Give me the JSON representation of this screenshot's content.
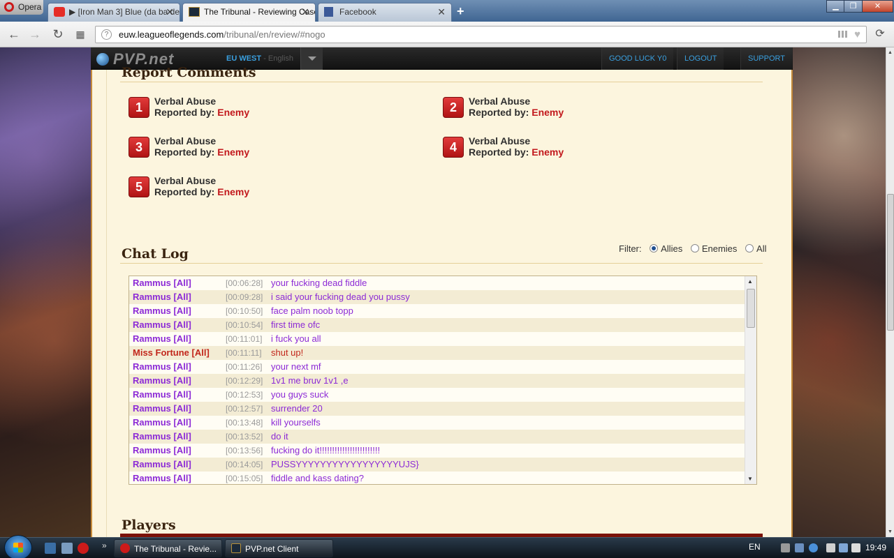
{
  "browser": {
    "menu_label": "Opera",
    "tabs": [
      {
        "label": "▶ [Iron Man 3] Blue (da ba dee)",
        "active": false,
        "icon": "youtube-icon"
      },
      {
        "label": "The Tribunal - Reviewing Case",
        "active": true,
        "icon": "lol-icon"
      },
      {
        "label": "Facebook",
        "active": false,
        "icon": "facebook-icon"
      }
    ],
    "url_host": "euw.leagueoflegends.com",
    "url_path": "/tribunal/en/review/#nogo"
  },
  "pvp_nav": {
    "logo": "PVP.net",
    "region": "EU WEST",
    "language": "English",
    "links": [
      "GOOD LUCK Y0",
      "LOGOUT",
      "SUPPORT"
    ]
  },
  "report_section": {
    "title": "Report Comments",
    "reported_by_label": "Reported by:",
    "reports": [
      {
        "num": "1",
        "type": "Verbal Abuse",
        "by": "Enemy"
      },
      {
        "num": "2",
        "type": "Verbal Abuse",
        "by": "Enemy"
      },
      {
        "num": "3",
        "type": "Verbal Abuse",
        "by": "Enemy"
      },
      {
        "num": "4",
        "type": "Verbal Abuse",
        "by": "Enemy"
      },
      {
        "num": "5",
        "type": "Verbal Abuse",
        "by": "Enemy"
      }
    ]
  },
  "chat_section": {
    "title": "Chat Log",
    "filter_label": "Filter:",
    "filter_options": [
      "Allies",
      "Enemies",
      "All"
    ],
    "filter_selected": "Allies",
    "rows": [
      {
        "name": "Rammus [All]",
        "time": "[00:06:28]",
        "msg": "your fucking dead fiddle",
        "side": "ally"
      },
      {
        "name": "Rammus [All]",
        "time": "[00:09:28]",
        "msg": "i said your fucking dead you pussy",
        "side": "ally"
      },
      {
        "name": "Rammus [All]",
        "time": "[00:10:50]",
        "msg": "face palm noob topp",
        "side": "ally"
      },
      {
        "name": "Rammus [All]",
        "time": "[00:10:54]",
        "msg": "first time ofc",
        "side": "ally"
      },
      {
        "name": "Rammus [All]",
        "time": "[00:11:01]",
        "msg": "i fuck you all",
        "side": "ally"
      },
      {
        "name": "Miss Fortune [All]",
        "time": "[00:11:11]",
        "msg": "shut up!",
        "side": "enemy"
      },
      {
        "name": "Rammus [All]",
        "time": "[00:11:26]",
        "msg": "your next mf",
        "side": "ally"
      },
      {
        "name": "Rammus [All]",
        "time": "[00:12:29]",
        "msg": "1v1 me bruv 1v1 ,e",
        "side": "ally"
      },
      {
        "name": "Rammus [All]",
        "time": "[00:12:53]",
        "msg": "you guys suck",
        "side": "ally"
      },
      {
        "name": "Rammus [All]",
        "time": "[00:12:57]",
        "msg": "surrender 20",
        "side": "ally"
      },
      {
        "name": "Rammus [All]",
        "time": "[00:13:48]",
        "msg": "kill yourselfs",
        "side": "ally"
      },
      {
        "name": "Rammus [All]",
        "time": "[00:13:52]",
        "msg": "do it",
        "side": "ally"
      },
      {
        "name": "Rammus [All]",
        "time": "[00:13:56]",
        "msg": "fucking do it!!!!!!!!!!!!!!!!!!!!!!!!",
        "side": "ally"
      },
      {
        "name": "Rammus [All]",
        "time": "[00:14:05]",
        "msg": "PUSSYYYYYYYYYYYYYYYYYUJS}",
        "side": "ally"
      },
      {
        "name": "Rammus [All]",
        "time": "[00:15:05]",
        "msg": "fiddle and kass dating?",
        "side": "ally"
      }
    ]
  },
  "players_section": {
    "title": "Players"
  },
  "taskbar": {
    "tasks": [
      "The Tribunal - Revie...",
      "PVP.net Client"
    ],
    "language": "EN",
    "clock": "19:49"
  },
  "colors": {
    "ally": "#8c2ad6",
    "enemy": "#c2271b",
    "accent": "#c58a3a"
  }
}
